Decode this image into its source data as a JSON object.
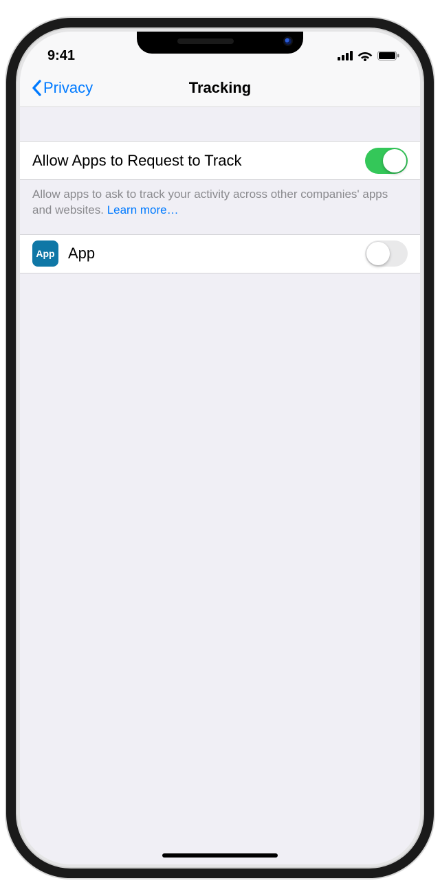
{
  "status": {
    "time": "9:41"
  },
  "nav": {
    "back_label": "Privacy",
    "title": "Tracking"
  },
  "settings": {
    "allow_request": {
      "label": "Allow Apps to Request to Track",
      "on": true
    },
    "footer_text": "Allow apps to ask to track your activity across other companies' apps and websites. ",
    "footer_link": "Learn more…"
  },
  "apps": [
    {
      "icon_label": "App",
      "name": "App",
      "on": false
    }
  ],
  "colors": {
    "accent_blue": "#007aff",
    "toggle_green": "#34c759"
  }
}
